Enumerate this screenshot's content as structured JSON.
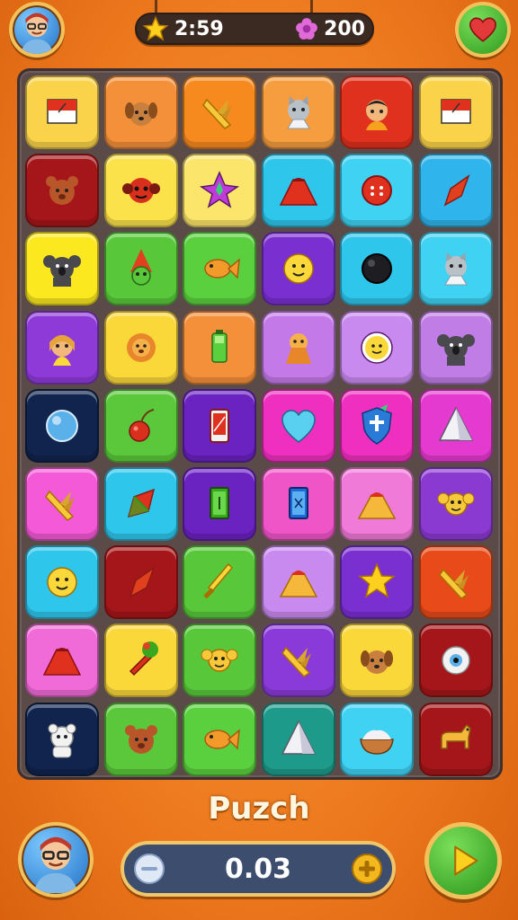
{
  "hud": {
    "timer": "2:59",
    "gems": "200"
  },
  "title": "Puzch",
  "score": "0.03",
  "icons": {
    "timer": "star-icon",
    "gems": "flower-gem-icon",
    "top_left": "player-avatar",
    "top_right": "heart-icon",
    "bottom_left": "player-avatar",
    "bottom_right": "play-icon",
    "score_left": "minus-icon",
    "score_right": "plus-icon"
  },
  "board": {
    "columns": 6,
    "rows": 9,
    "tiles": [
      {
        "color": "#fbd34a",
        "icon": "flag"
      },
      {
        "color": "#f4903a",
        "icon": "dog"
      },
      {
        "color": "#f78a1f",
        "icon": "corn"
      },
      {
        "color": "#f59d3f",
        "icon": "cat"
      },
      {
        "color": "#e0301e",
        "icon": "boy"
      },
      {
        "color": "#fbd34a",
        "icon": "flag"
      },
      {
        "color": "#a5161a",
        "icon": "bear"
      },
      {
        "color": "#fbe14a",
        "icon": "red-monkey"
      },
      {
        "color": "#fbe56a",
        "icon": "star-gem"
      },
      {
        "color": "#2fc6ec",
        "icon": "volcano-red"
      },
      {
        "color": "#3fd2f2",
        "icon": "red-button"
      },
      {
        "color": "#2fb5ec",
        "icon": "kite"
      },
      {
        "color": "#fbe81e",
        "icon": "koala"
      },
      {
        "color": "#58c83a",
        "icon": "gnome"
      },
      {
        "color": "#5ad03e",
        "icon": "goldfish"
      },
      {
        "color": "#7a2fd0",
        "icon": "moon-face"
      },
      {
        "color": "#2fc6ec",
        "icon": "black-circle"
      },
      {
        "color": "#3fd2f2",
        "icon": "cat"
      },
      {
        "color": "#8e3ad8",
        "icon": "girl"
      },
      {
        "color": "#fbd83a",
        "icon": "lion"
      },
      {
        "color": "#f5903a",
        "icon": "battery"
      },
      {
        "color": "#c37ae8",
        "icon": "lion-cape"
      },
      {
        "color": "#c98af0",
        "icon": "sun-badge"
      },
      {
        "color": "#c07de6",
        "icon": "koala"
      },
      {
        "color": "#10244e",
        "icon": "blue-orb"
      },
      {
        "color": "#5ac83a",
        "icon": "cherry"
      },
      {
        "color": "#6a22c0",
        "icon": "phone"
      },
      {
        "color": "#ef2fbf",
        "icon": "heart"
      },
      {
        "color": "#ef2fbf",
        "icon": "shield"
      },
      {
        "color": "#e53ad0",
        "icon": "pyramid"
      },
      {
        "color": "#f45ad8",
        "icon": "corn"
      },
      {
        "color": "#2fc6ec",
        "icon": "leaf-kite"
      },
      {
        "color": "#6a22c0",
        "icon": "green-card"
      },
      {
        "color": "#f055c8",
        "icon": "blue-card"
      },
      {
        "color": "#f07ad8",
        "icon": "volcano"
      },
      {
        "color": "#8a3ad0",
        "icon": "monkey"
      },
      {
        "color": "#2fc6ec",
        "icon": "moon-face"
      },
      {
        "color": "#a5161a",
        "icon": "kite"
      },
      {
        "color": "#58c83a",
        "icon": "sword"
      },
      {
        "color": "#c98af0",
        "icon": "volcano"
      },
      {
        "color": "#7a2fd0",
        "icon": "star"
      },
      {
        "color": "#e84a1a",
        "icon": "corn"
      },
      {
        "color": "#f06ad8",
        "icon": "volcano-red"
      },
      {
        "color": "#fbd83a",
        "icon": "torch"
      },
      {
        "color": "#58c83a",
        "icon": "monkey"
      },
      {
        "color": "#8a3ad8",
        "icon": "corn"
      },
      {
        "color": "#fbd83a",
        "icon": "dog"
      },
      {
        "color": "#a5161a",
        "icon": "eye"
      },
      {
        "color": "#10244e",
        "icon": "white-bear"
      },
      {
        "color": "#5ac83a",
        "icon": "bear"
      },
      {
        "color": "#5ad03e",
        "icon": "goldfish"
      },
      {
        "color": "#1e9a8a",
        "icon": "pyramid"
      },
      {
        "color": "#3fd2f2",
        "icon": "rice-bowl"
      },
      {
        "color": "#a5161a",
        "icon": "horse"
      }
    ]
  }
}
